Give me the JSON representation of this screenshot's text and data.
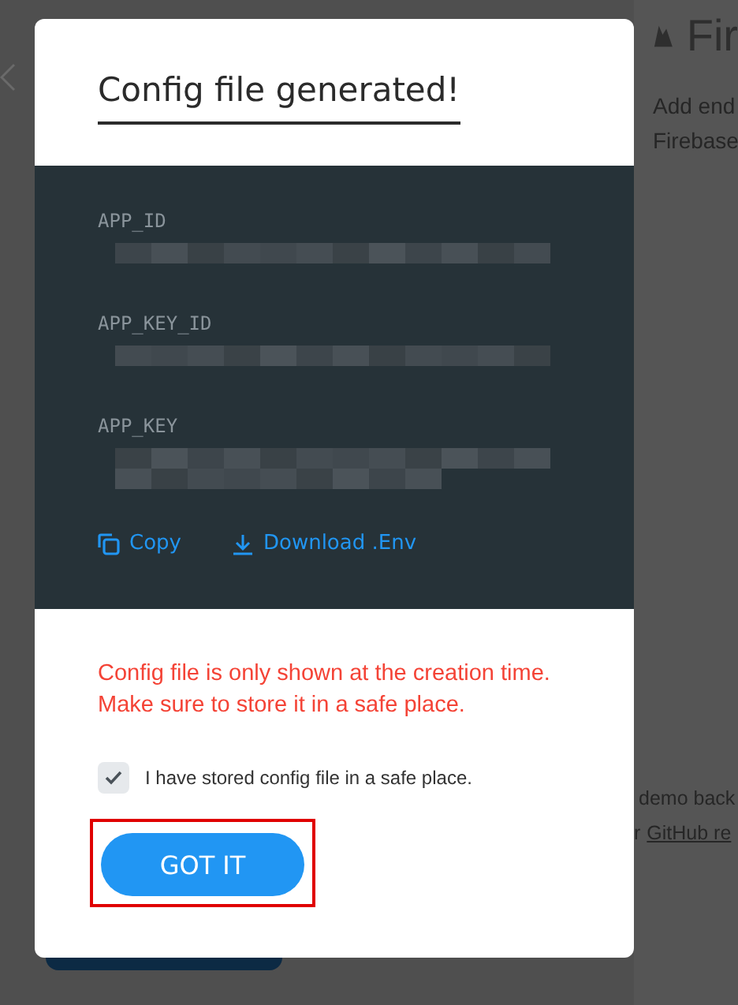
{
  "background": {
    "header": "Fir",
    "description": [
      "Add end",
      "Firebase"
    ],
    "note": "demo back",
    "link_prefix": "r",
    "link": "GitHub re"
  },
  "dialog": {
    "title": "Config file generated!",
    "entries": [
      {
        "key": "APP_ID"
      },
      {
        "key": "APP_KEY_ID"
      },
      {
        "key": "APP_KEY"
      }
    ],
    "actions": [
      {
        "kind": "copy",
        "label": "Copy"
      },
      {
        "kind": "download",
        "label": "Download .Env"
      }
    ],
    "warning": [
      "Config file is only shown at the creation time.",
      "Make sure to store it in a safe place."
    ],
    "checkbox": {
      "label": "I have stored config file in a safe place.",
      "checked": true
    },
    "button": {
      "label": "GOT IT",
      "highlighted": true
    }
  }
}
